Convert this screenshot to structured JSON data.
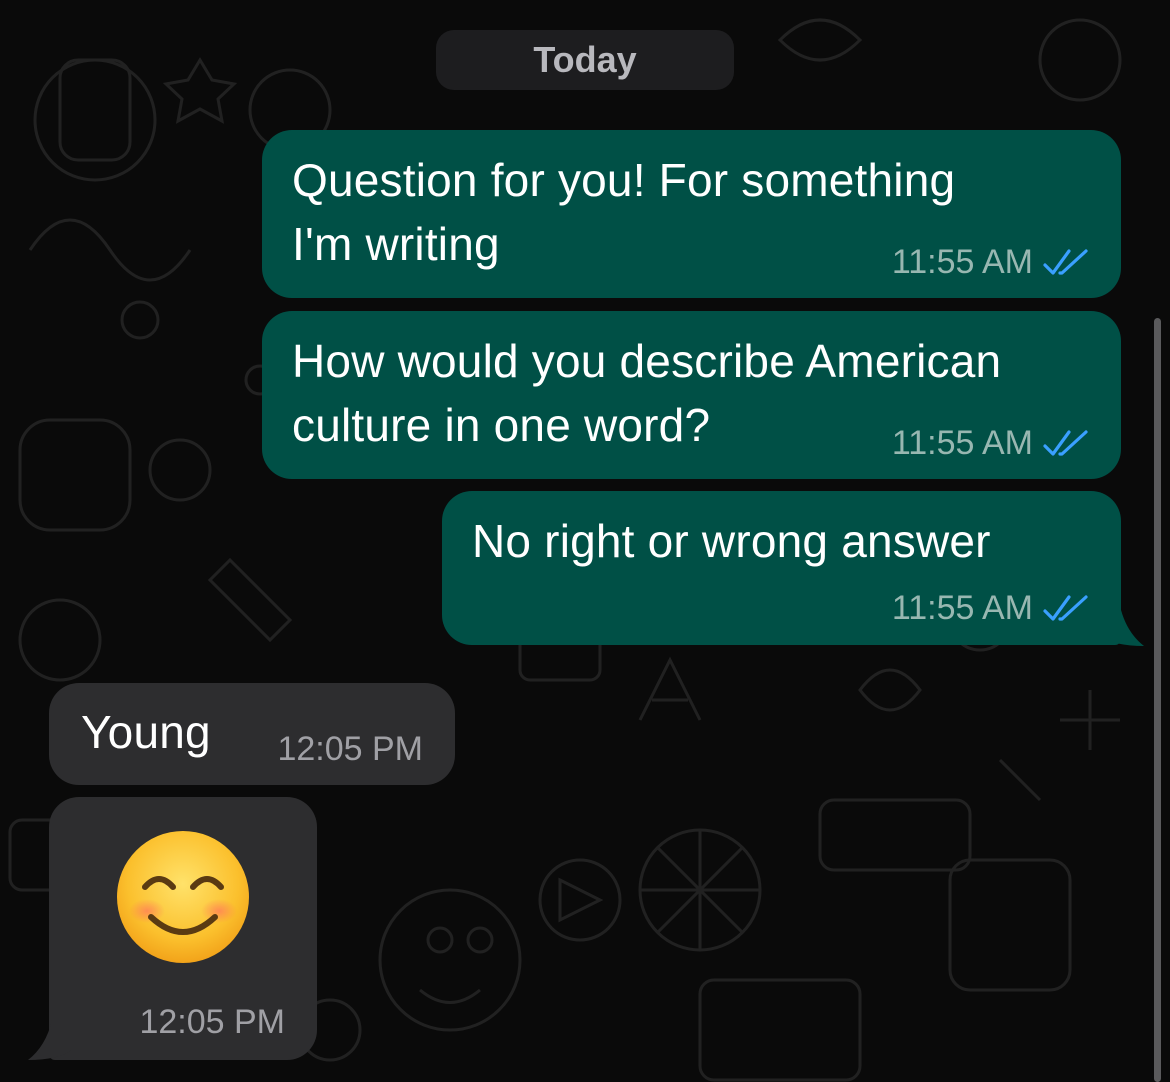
{
  "date_label": "Today",
  "colors": {
    "outgoing_bubble": "#005046",
    "incoming_bubble": "#2d2d2f",
    "read_ticks": "#3aa0ff",
    "background": "#0a0a0a"
  },
  "messages": [
    {
      "direction": "outgoing",
      "text": "Question for you! For something\nI'm writing",
      "time": "11:55 AM",
      "status": "read",
      "status_icon": "double-check-icon"
    },
    {
      "direction": "outgoing",
      "text": "How would you describe American\nculture in one word?",
      "time": "11:55 AM",
      "status": "read",
      "status_icon": "double-check-icon"
    },
    {
      "direction": "outgoing",
      "text": "No right or wrong answer",
      "time": "11:55 AM",
      "status": "read",
      "status_icon": "double-check-icon"
    },
    {
      "direction": "incoming",
      "text": "Young",
      "time": "12:05 PM"
    },
    {
      "direction": "incoming",
      "emoji_icon": "smiling-face-with-smiling-eyes-emoji",
      "time": "12:05 PM"
    }
  ]
}
